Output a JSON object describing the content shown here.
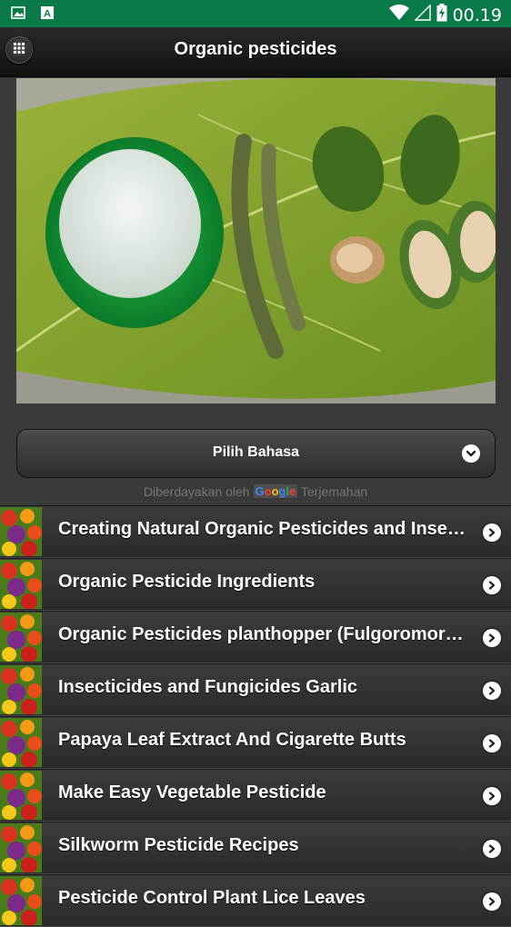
{
  "status_bar": {
    "time": "00.19",
    "icons": [
      "image-icon",
      "keyboard-a-icon",
      "wifi-icon",
      "signal-icon",
      "battery-charging-icon"
    ],
    "background": "#0b7a4b"
  },
  "header": {
    "title": "Organic pesticides",
    "menu_icon": "grid-icon"
  },
  "hero_image": {
    "subject": "organic pesticide ingredients: white powder in green jar, seed pods, green fruits on leaf"
  },
  "language": {
    "select_label": "Pilih Bahasa",
    "powered_by_prefix": "Diberdayakan oleh",
    "powered_by_brand": "Google",
    "powered_by_suffix": "Terjemahan"
  },
  "list": {
    "items": [
      {
        "label": "Creating Natural Organic Pesticides and Insecticides"
      },
      {
        "label": "Organic Pesticide Ingredients"
      },
      {
        "label": "Organic Pesticides planthopper (Fulgoromorpha)"
      },
      {
        "label": "Insecticides and Fungicides Garlic"
      },
      {
        "label": "Papaya Leaf Extract And Cigarette Butts"
      },
      {
        "label": "Make Easy Vegetable Pesticide"
      },
      {
        "label": "Silkworm Pesticide Recipes"
      },
      {
        "label": "Pesticide Control Plant Lice Leaves"
      }
    ]
  },
  "colors": {
    "accent": "#0b7a4b",
    "header_bg": "#1a1a1a",
    "list_bg": "#333333",
    "text": "#ffffff"
  }
}
